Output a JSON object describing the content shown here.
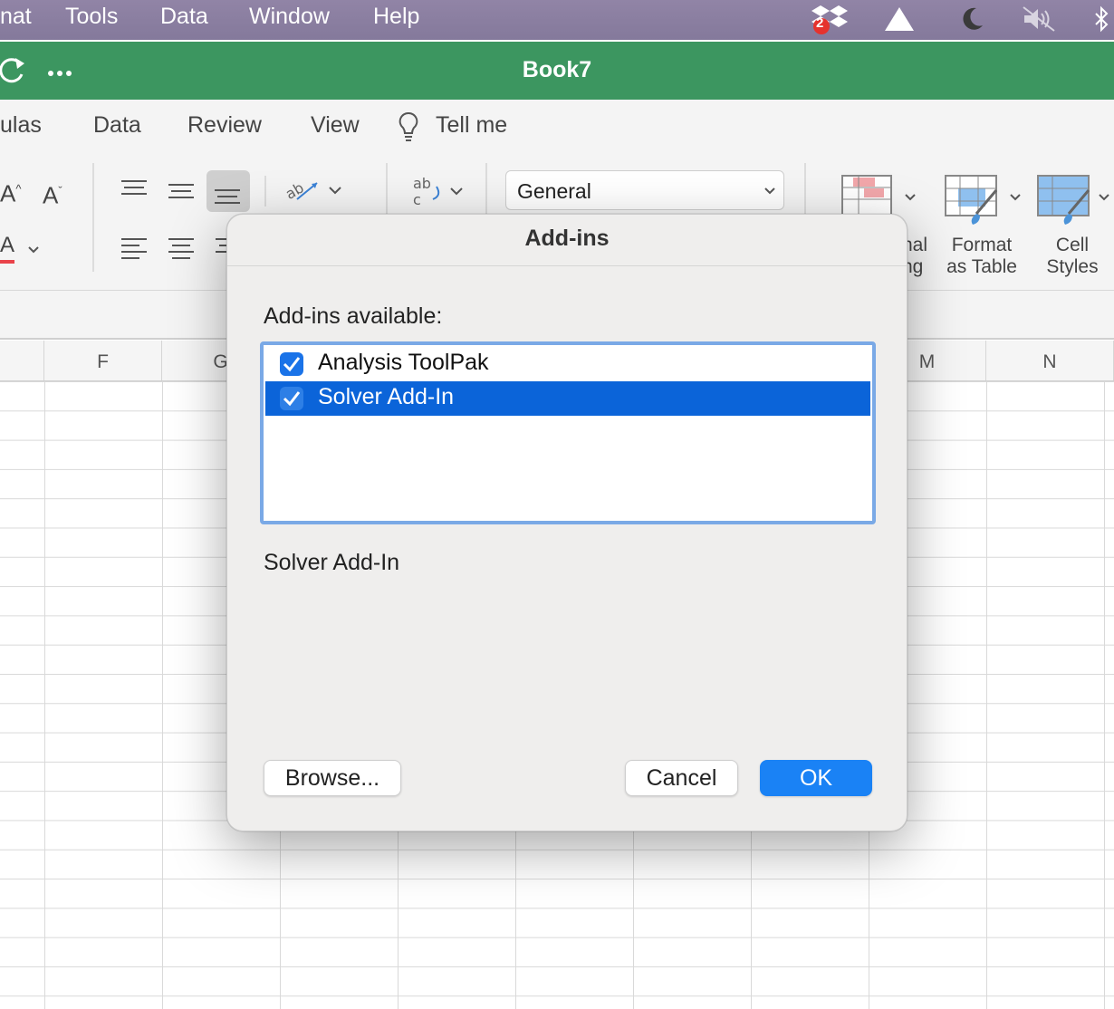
{
  "menubar": {
    "items": [
      "nat",
      "Tools",
      "Data",
      "Window",
      "Help"
    ],
    "dropbox_badge": "2"
  },
  "window": {
    "title": "Book7"
  },
  "tabs": [
    "ulas",
    "Data",
    "Review",
    "View",
    "Tell me"
  ],
  "ribbon": {
    "number_format": "General",
    "cond_format_label": [
      "nal",
      "ng"
    ],
    "format_as_table_label": [
      "Format",
      "as Table"
    ],
    "cell_styles_label": [
      "Cell",
      "Styles"
    ]
  },
  "columns": [
    "F",
    "G",
    "M",
    "N"
  ],
  "dialog": {
    "title": "Add-ins",
    "available_label": "Add-ins available:",
    "addins": [
      {
        "name": "Analysis ToolPak",
        "checked": true,
        "selected": false
      },
      {
        "name": "Solver Add-In",
        "checked": true,
        "selected": true
      }
    ],
    "description": "Solver Add-In",
    "browse_label": "Browse...",
    "cancel_label": "Cancel",
    "ok_label": "OK"
  },
  "colors": {
    "accent": "#1a82f5",
    "title_bar": "#3c9660",
    "selection": "#0b64d9"
  }
}
